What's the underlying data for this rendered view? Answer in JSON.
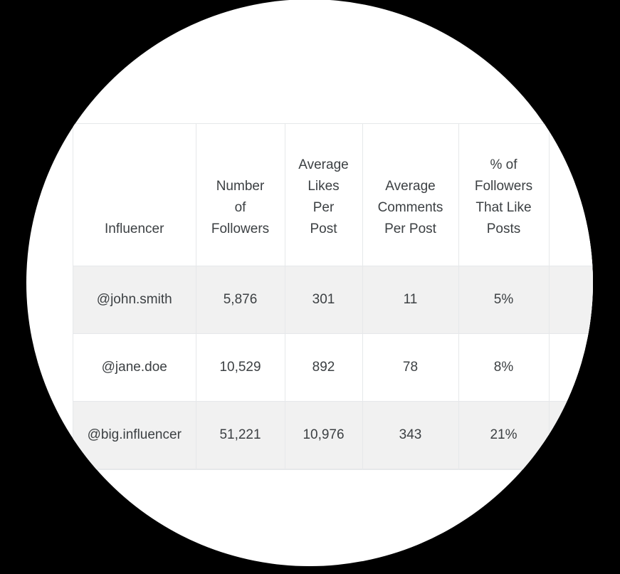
{
  "theme": {
    "backdrop_color": "#000000",
    "stage_color": "#ffffff",
    "border_color": "#e6e8ea",
    "text_color": "#3c4043",
    "row_stripe_color": "#f1f1f1",
    "row_plain_color": "#ffffff"
  },
  "table": {
    "headers": [
      "Influencer",
      "Number\nof\nFollowers",
      "Average\nLikes\nPer\nPost",
      "Average\nComments\nPer Post",
      "% of\nFollowers\nThat Like\nPosts",
      ""
    ],
    "rows": [
      {
        "influencer": "@john.smith",
        "number_of_followers": "5,876",
        "average_likes_per_post": "301",
        "average_comments_per_post": "11",
        "percent_followers_that_like_posts": "5%",
        "extra": ""
      },
      {
        "influencer": "@jane.doe",
        "number_of_followers": "10,529",
        "average_likes_per_post": "892",
        "average_comments_per_post": "78",
        "percent_followers_that_like_posts": "8%",
        "extra": ""
      },
      {
        "influencer": "@big.influencer",
        "number_of_followers": "51,221",
        "average_likes_per_post": "10,976",
        "average_comments_per_post": "343",
        "percent_followers_that_like_posts": "21%",
        "extra": ""
      }
    ]
  },
  "chart_data": {
    "type": "table",
    "title": "",
    "columns": [
      "Influencer",
      "Number of Followers",
      "Average Likes Per Post",
      "Average Comments Per Post",
      "% of Followers That Like Posts"
    ],
    "records": [
      {
        "Influencer": "@john.smith",
        "Number of Followers": 5876,
        "Average Likes Per Post": 301,
        "Average Comments Per Post": 11,
        "% of Followers That Like Posts": 5
      },
      {
        "Influencer": "@jane.doe",
        "Number of Followers": 10529,
        "Average Likes Per Post": 892,
        "Average Comments Per Post": 78,
        "% of Followers That Like Posts": 8
      },
      {
        "Influencer": "@big.influencer",
        "Number of Followers": 51221,
        "Average Likes Per Post": 10976,
        "Average Comments Per Post": 343,
        "% of Followers That Like Posts": 21
      }
    ]
  }
}
